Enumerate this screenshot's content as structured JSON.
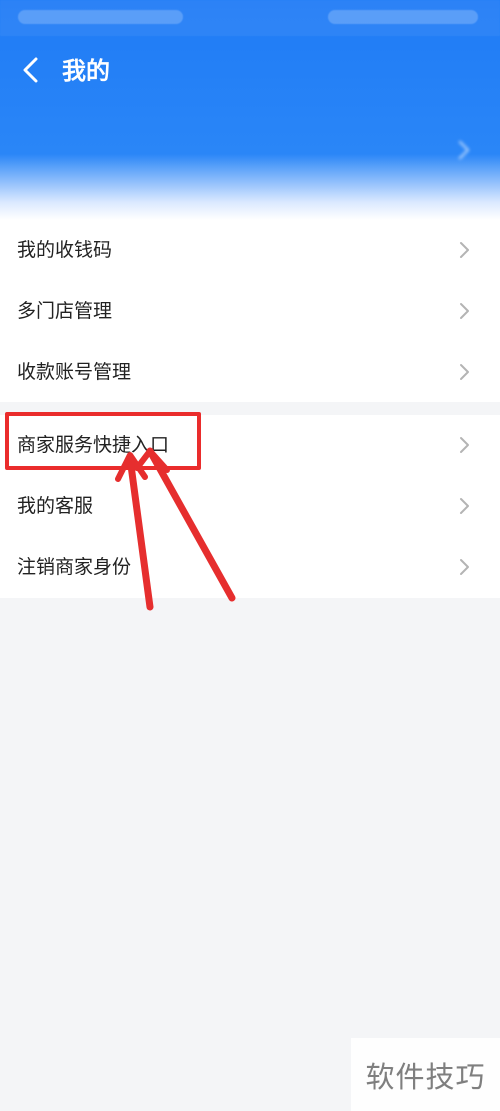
{
  "header": {
    "title": "我的",
    "status_left": "",
    "status_right": ""
  },
  "profile": {
    "name": "",
    "subtext": ""
  },
  "menu": {
    "group1": [
      {
        "label": "我的收钱码"
      },
      {
        "label": "多门店管理"
      },
      {
        "label": "收款账号管理"
      }
    ],
    "group2": [
      {
        "label": "商家服务快捷入口"
      },
      {
        "label": "我的客服"
      },
      {
        "label": "注销商家身份"
      }
    ]
  },
  "watermark": {
    "text": "软件技巧"
  },
  "colors": {
    "header_blue": "#1f7bf6",
    "highlight_red": "#ea2c2c",
    "chevron_gray": "#b4b4b4"
  },
  "icons": {
    "back": "chevron-left-icon",
    "row_chevron": "chevron-right-icon"
  }
}
